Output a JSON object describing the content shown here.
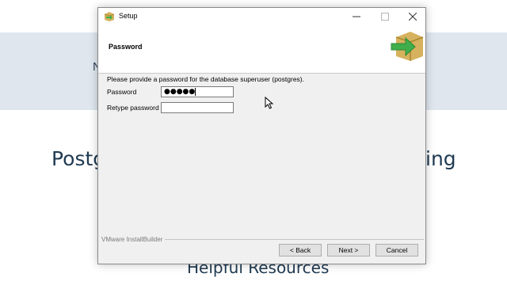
{
  "background_page": {
    "band_letter": "N",
    "heading_left": "Postg",
    "heading_right": "ing",
    "subheading": "Helpful Resources"
  },
  "window": {
    "title": "Setup",
    "section_title": "Password",
    "instruction": "Please provide a password for the database superuser (postgres).",
    "password_label": "Password",
    "password_value": "●●●●●",
    "retype_label": "Retype password",
    "retype_value": "",
    "brand": "VMware InstallBuilder",
    "buttons": {
      "back": "< Back",
      "next": "Next >",
      "cancel": "Cancel"
    }
  },
  "colors": {
    "band_background": "#dfe6ee",
    "heading_text": "#1f3a52",
    "box_icon_tan": "#d6b25e",
    "box_icon_green": "#3fae4b"
  },
  "icons": [
    "app-icon",
    "minimize-icon",
    "maximize-icon",
    "close-icon",
    "installer-box-icon",
    "mouse-cursor-icon"
  ]
}
